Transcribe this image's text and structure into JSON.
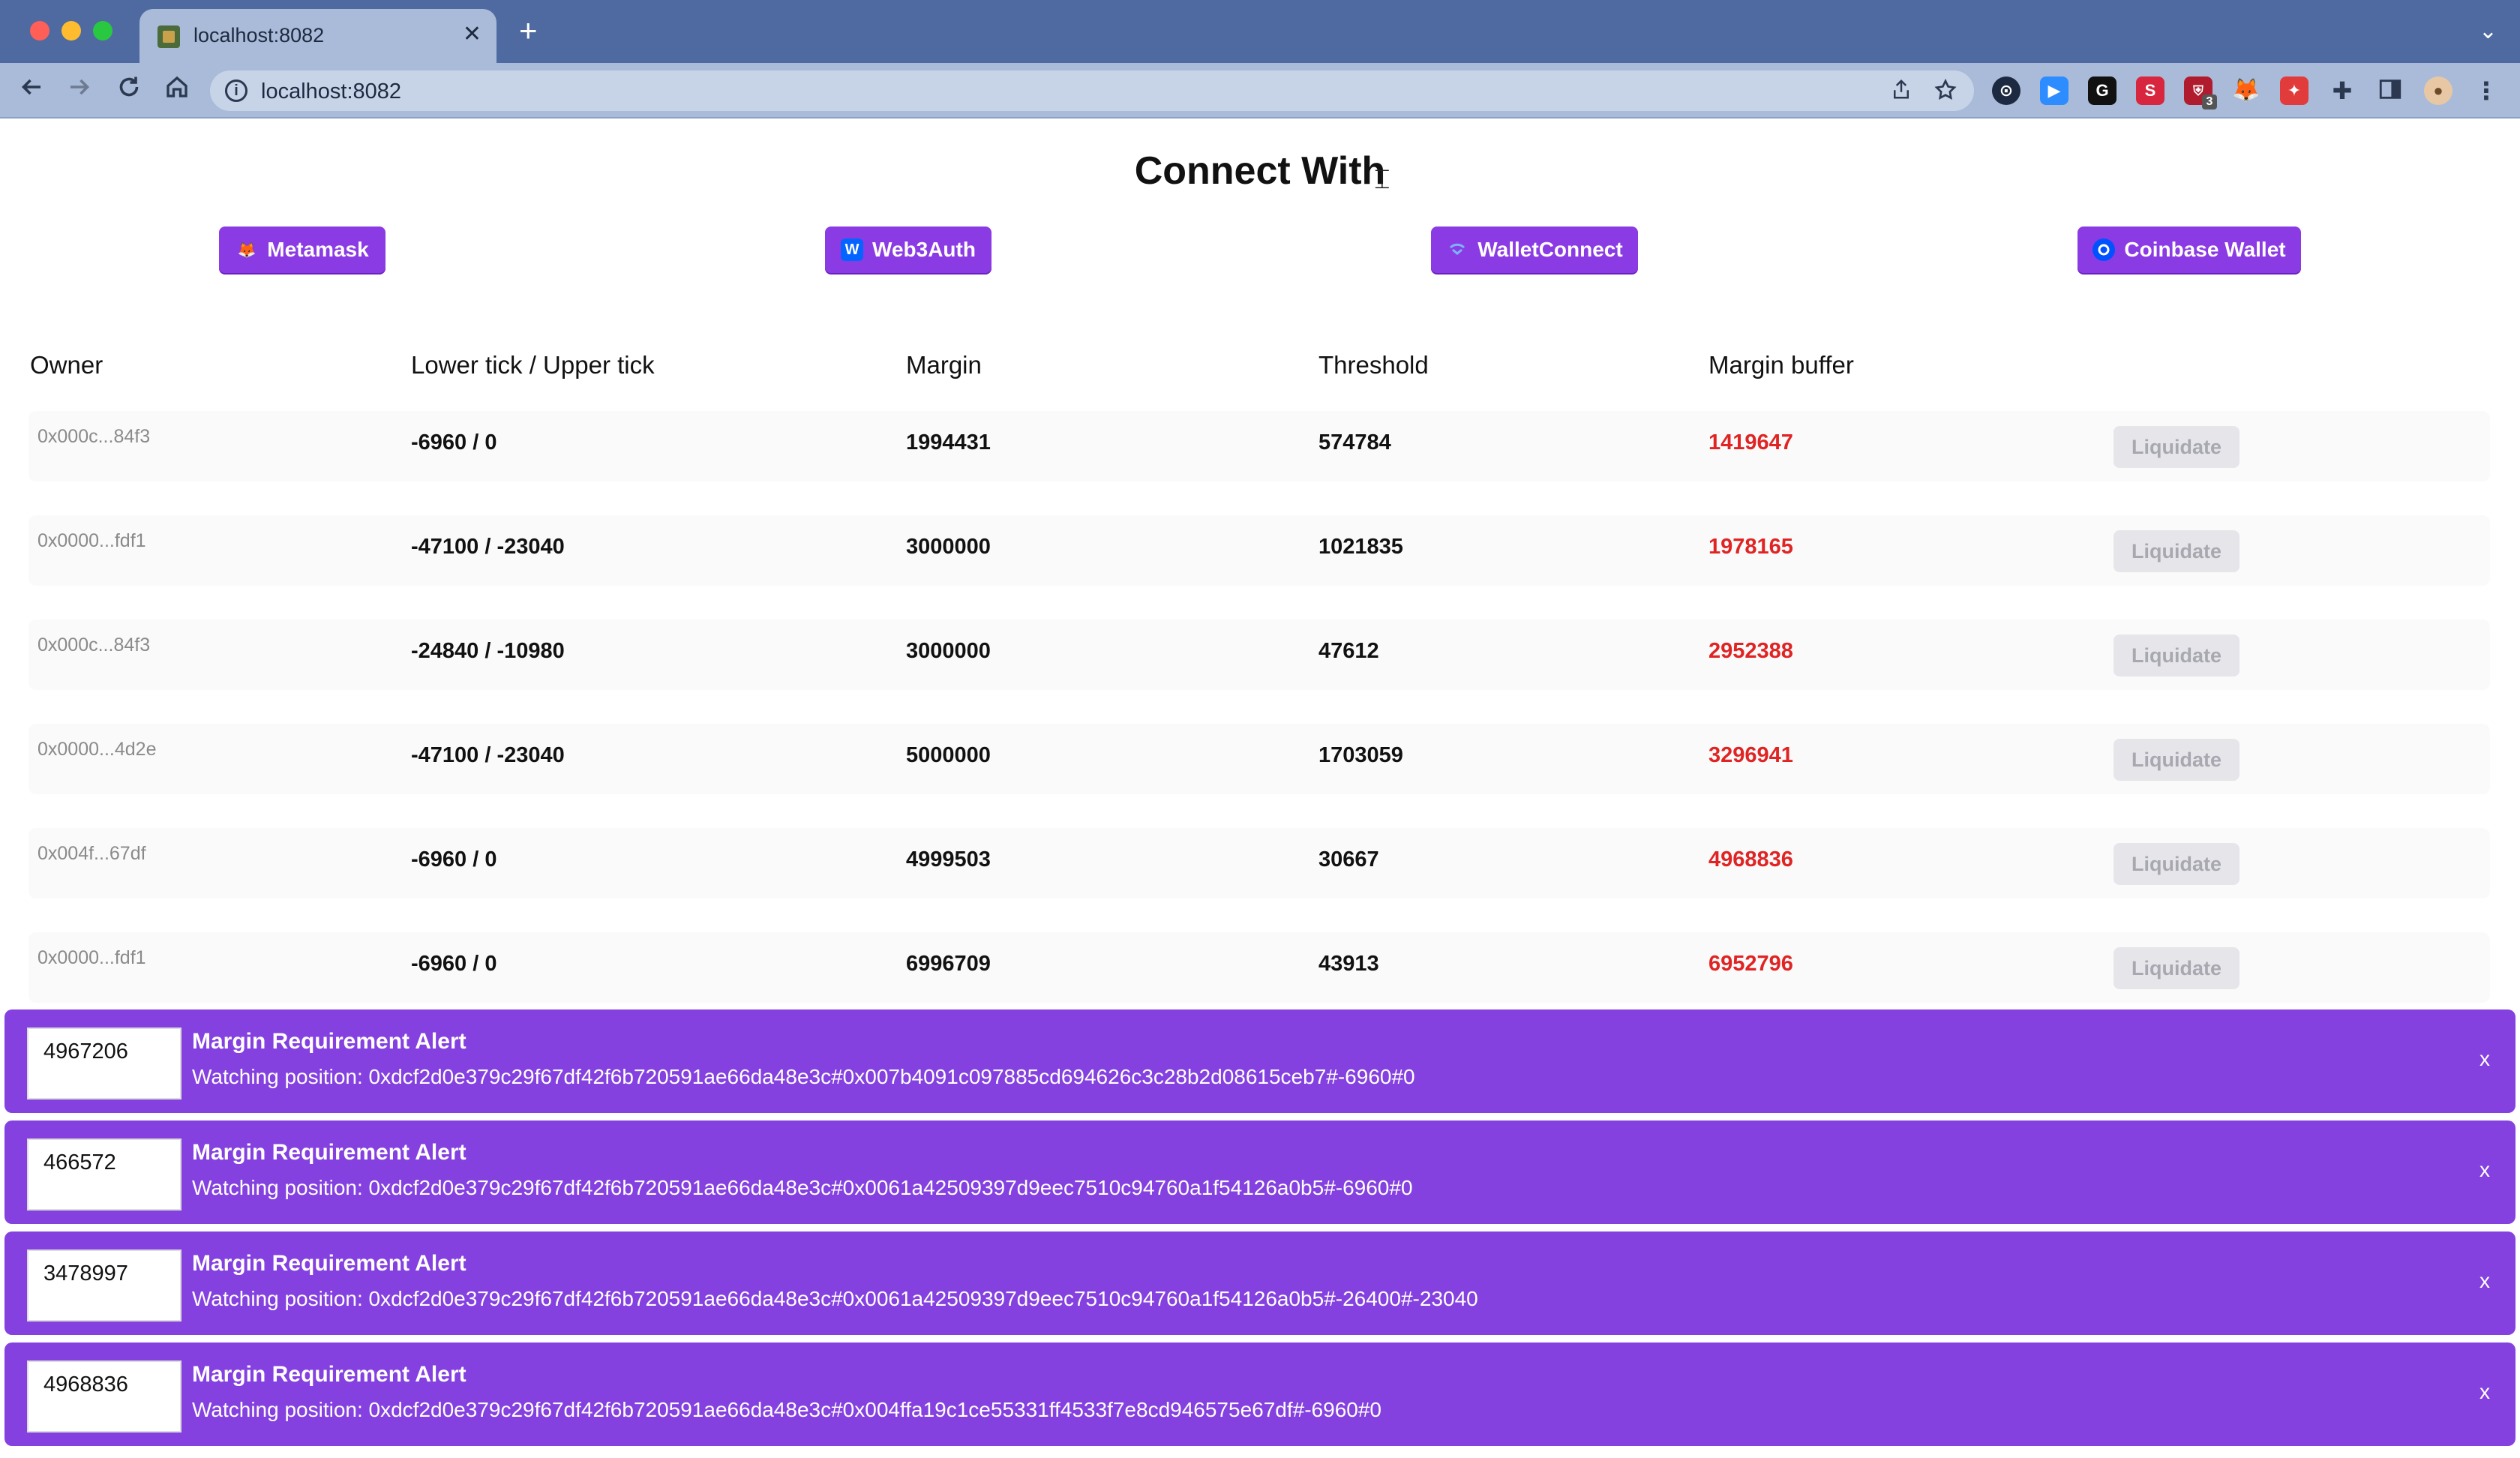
{
  "browser": {
    "tab_title": "localhost:8082",
    "tab_close": "✕",
    "new_tab": "+",
    "tab_list": "⌄",
    "url": "localhost:8082",
    "ext_badge": "3"
  },
  "page": {
    "title": "Connect With"
  },
  "wallets": [
    {
      "label": "Metamask",
      "icon": "fox-icon"
    },
    {
      "label": "Web3Auth",
      "icon": "w-icon",
      "icon_letter": "W"
    },
    {
      "label": "WalletConnect",
      "icon": "walletconnect-icon"
    },
    {
      "label": "Coinbase Wallet",
      "icon": "coinbase-icon"
    }
  ],
  "table": {
    "headers": [
      "Owner",
      "Lower tick / Upper tick",
      "Margin",
      "Threshold",
      "Margin buffer"
    ],
    "liquidate_label": "Liquidate",
    "rows": [
      {
        "owner": "0x000c...84f3",
        "ticks": "-6960 / 0",
        "margin": "1994431",
        "threshold": "574784",
        "buffer": "1419647"
      },
      {
        "owner": "0x0000...fdf1",
        "ticks": "-47100 / -23040",
        "margin": "3000000",
        "threshold": "1021835",
        "buffer": "1978165"
      },
      {
        "owner": "0x000c...84f3",
        "ticks": "-24840 / -10980",
        "margin": "3000000",
        "threshold": "47612",
        "buffer": "2952388"
      },
      {
        "owner": "0x0000...4d2e",
        "ticks": "-47100 / -23040",
        "margin": "5000000",
        "threshold": "1703059",
        "buffer": "3296941"
      },
      {
        "owner": "0x004f...67df",
        "ticks": "-6960 / 0",
        "margin": "4999503",
        "threshold": "30667",
        "buffer": "4968836"
      },
      {
        "owner": "0x0000...fdf1",
        "ticks": "-6960 / 0",
        "margin": "6996709",
        "threshold": "43913",
        "buffer": "6952796"
      }
    ]
  },
  "alerts": [
    {
      "value": "4967206",
      "title": "Margin Requirement Alert",
      "message": "Watching position: 0xdcf2d0e379c29f67df42f6b720591ae66da48e3c#0x007b4091c097885cd694626c3c28b2d08615ceb7#-6960#0",
      "close": "x"
    },
    {
      "value": "466572",
      "title": "Margin Requirement Alert",
      "message": "Watching position: 0xdcf2d0e379c29f67df42f6b720591ae66da48e3c#0x0061a42509397d9eec7510c94760a1f54126a0b5#-6960#0",
      "close": "x"
    },
    {
      "value": "3478997",
      "title": "Margin Requirement Alert",
      "message": "Watching position: 0xdcf2d0e379c29f67df42f6b720591ae66da48e3c#0x0061a42509397d9eec7510c94760a1f54126a0b5#-26400#-23040",
      "close": "x"
    },
    {
      "value": "4968836",
      "title": "Margin Requirement Alert",
      "message": "Watching position: 0xdcf2d0e379c29f67df42f6b720591ae66da48e3c#0x004ffa19c1ce55331ff4533f7e8cd946575e67df#-6960#0",
      "close": "x"
    }
  ],
  "colors": {
    "accent": "#8b3be3",
    "alert_bg": "#8441e0",
    "buffer_red": "#e02424"
  }
}
